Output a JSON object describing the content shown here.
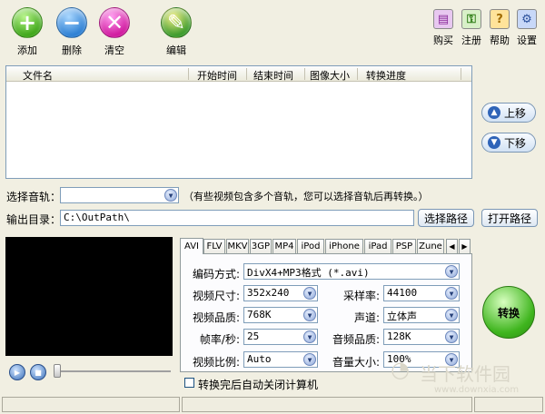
{
  "toolbar": {
    "add": "添加",
    "delete": "删除",
    "clear": "清空",
    "edit": "编辑"
  },
  "top_right": {
    "buy": "购买",
    "register": "注册",
    "help": "帮助",
    "settings": "设置"
  },
  "file_list": {
    "columns": [
      "文件名",
      "开始时间",
      "结束时间",
      "图像大小",
      "转换进度"
    ]
  },
  "side": {
    "move_up": "上移",
    "move_down": "下移"
  },
  "audio": {
    "label": "选择音轨：",
    "value": "",
    "hint": "（有些视频包含多个音轨，您可以选择音轨后再转换。）"
  },
  "output": {
    "label": "输出目录：",
    "value": "C:\\OutPath\\",
    "choose": "选择路径",
    "open": "打开路径"
  },
  "tabs": [
    "AVI",
    "FLV",
    "MKV",
    "3GP",
    "MP4",
    "iPod",
    "iPhone",
    "iPad",
    "PSP",
    "Zune"
  ],
  "settings": {
    "encode_label": "编码方式:",
    "encode_value": "DivX4+MP3格式 (*.avi)",
    "size_label": "视频尺寸:",
    "size_value": "352x240",
    "samplerate_label": "采样率:",
    "samplerate_value": "44100",
    "vquality_label": "视频品质:",
    "vquality_value": "768K",
    "channel_label": "声道:",
    "channel_value": "立体声",
    "fps_label": "帧率/秒:",
    "fps_value": "25",
    "aquality_label": "音频品质:",
    "aquality_value": "128K",
    "ratio_label": "视频比例:",
    "ratio_value": "Auto",
    "volume_label": "音量大小:",
    "volume_value": "100%"
  },
  "shutdown_label": "转换完后自动关闭计算机",
  "convert_label": "转换",
  "watermark": {
    "text": "当下软件园",
    "url": "www.downxia.com"
  }
}
